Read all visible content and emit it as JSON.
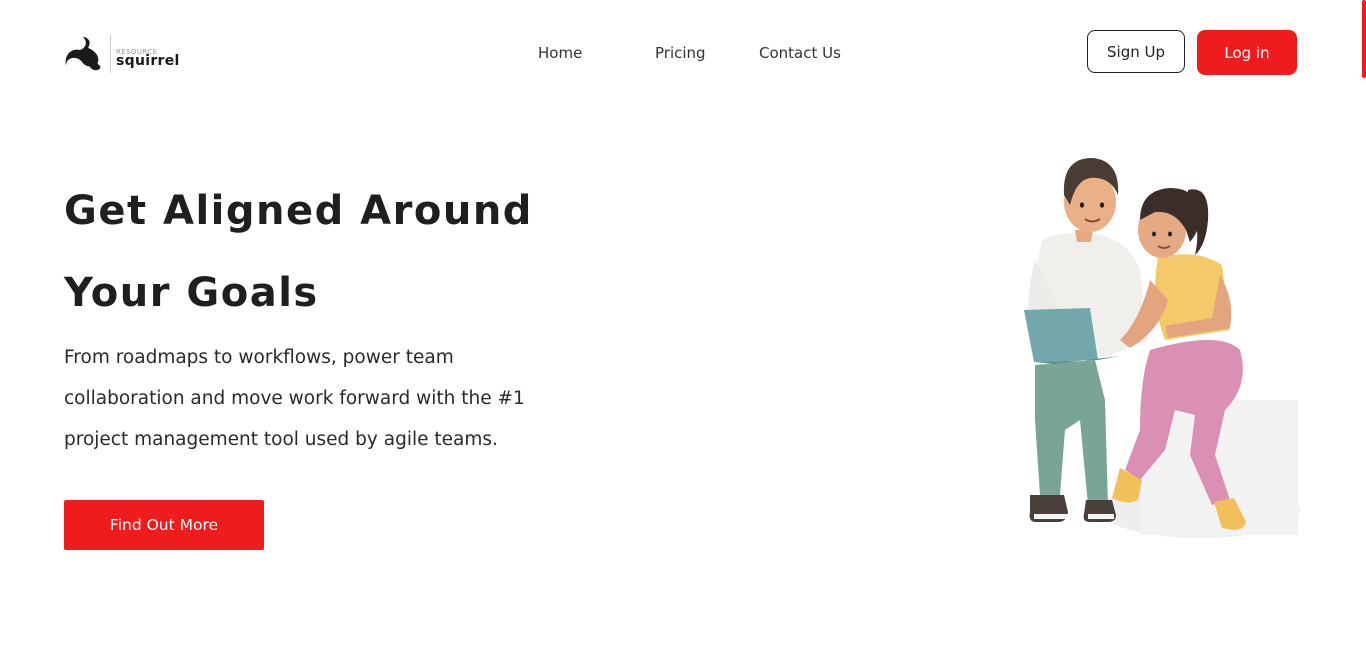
{
  "brand": {
    "name_small": "RESOURCE",
    "name_big": "squirrel",
    "logo_icon": "squirrel-wave-icon"
  },
  "nav": {
    "items": [
      "Home",
      "Pricing",
      "Contact Us"
    ]
  },
  "auth": {
    "signup_label": "Sign Up",
    "login_label": "Log in"
  },
  "hero": {
    "title_lines": [
      "Get Aligned Around",
      "Your Goals"
    ],
    "description_lines": [
      "From roadmaps to workflows, power team",
      "collaboration and move work forward with the #1",
      "project management tool used by agile teams."
    ],
    "cta_label": "Find Out More",
    "illustration": "two-people-with-laptop-illustration"
  },
  "colors": {
    "accent": "#ee1c1c",
    "text": "#222222",
    "background": "#ffffff"
  }
}
